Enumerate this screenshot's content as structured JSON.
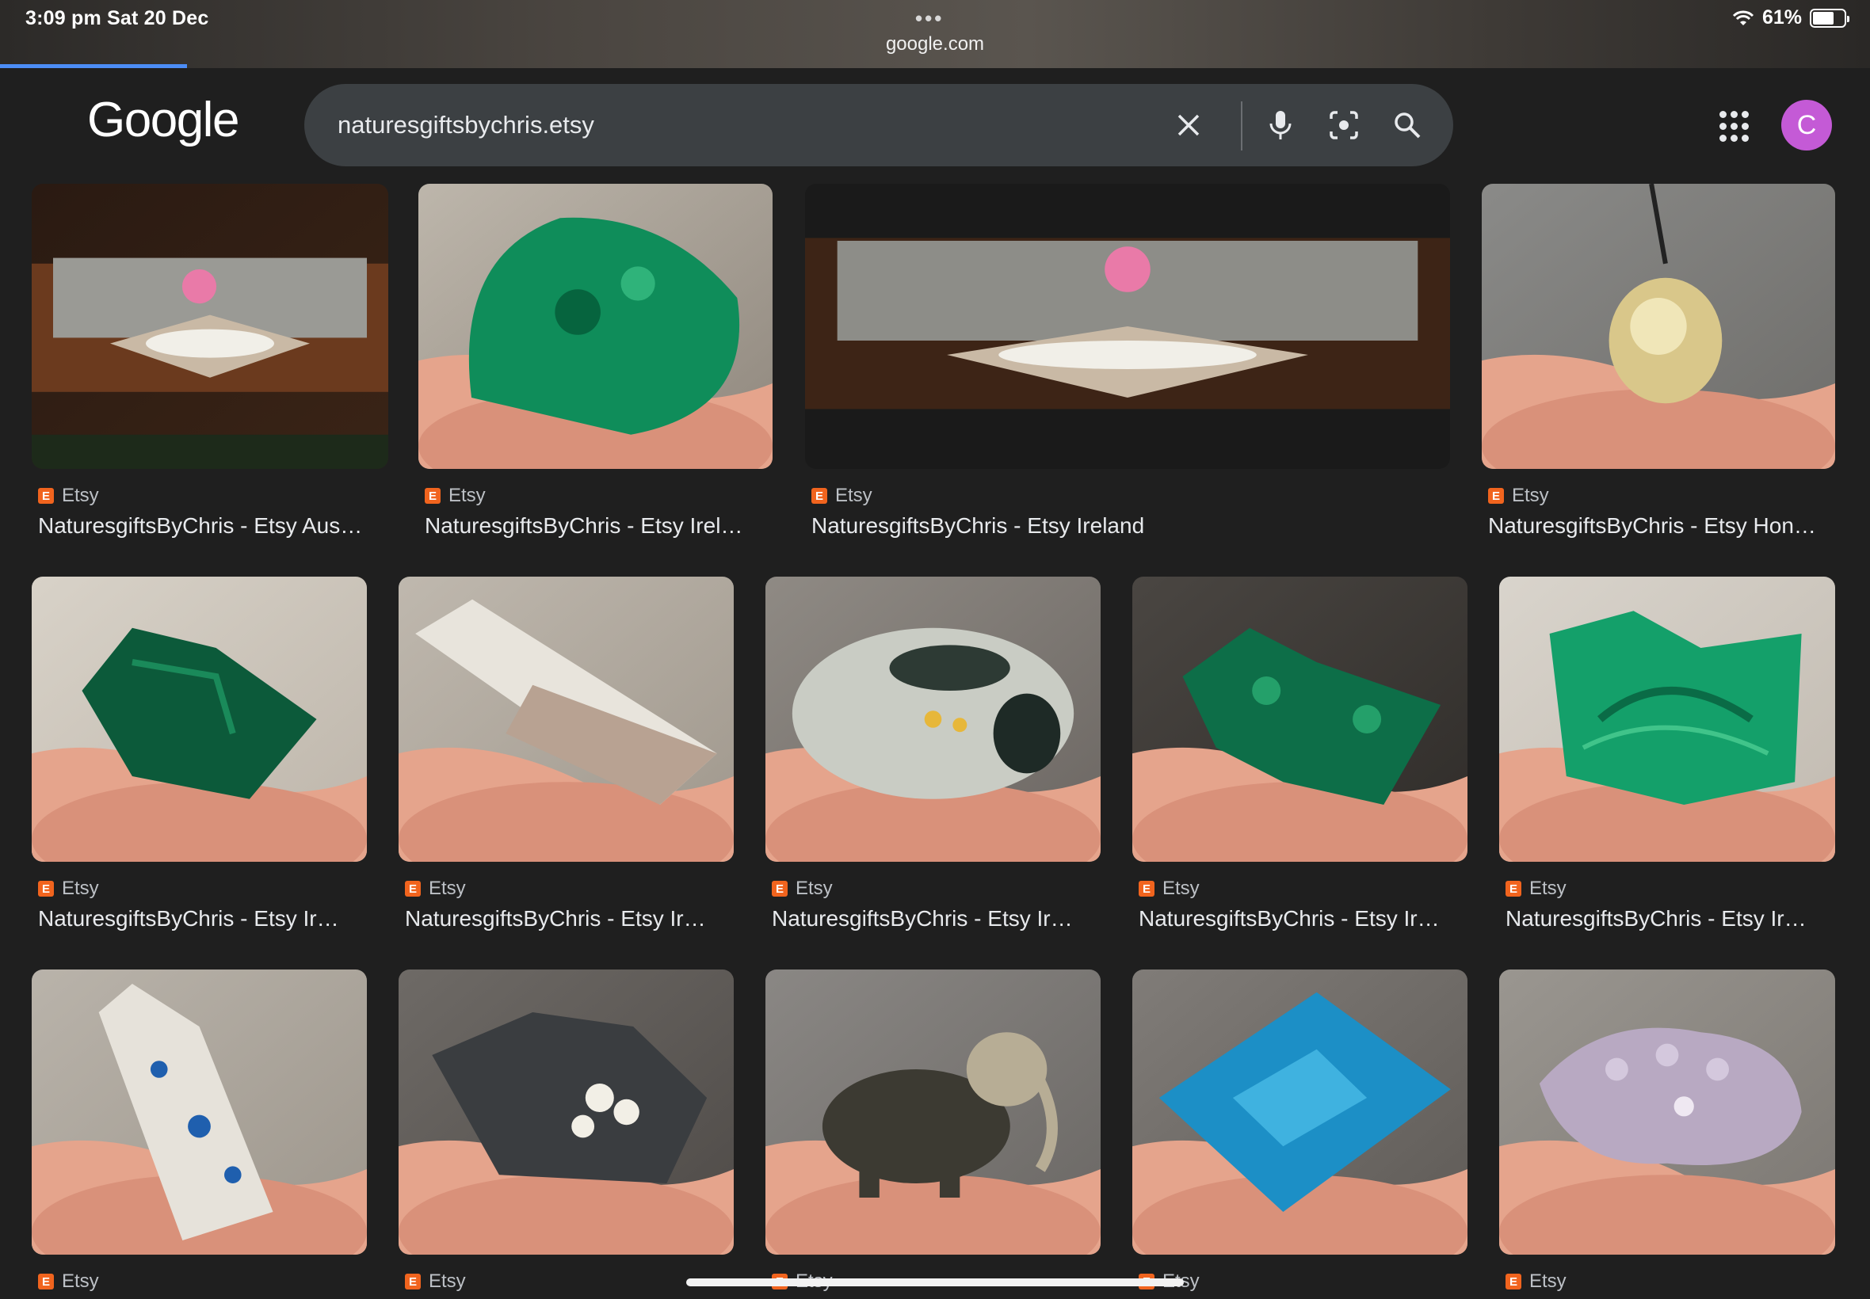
{
  "status": {
    "time": "3:09 pm  Sat 20 Dec",
    "battery": "61%",
    "battery_level": 0.61,
    "url": "google.com"
  },
  "header": {
    "logo": "Google",
    "query": "naturesgiftsbychris.etsy",
    "avatar_letter": "C"
  },
  "results": [
    {
      "source": "Etsy",
      "title": "NaturesgiftsByChris - Etsy Aus…",
      "image": "om-altar-tray"
    },
    {
      "source": "Etsy",
      "title": "NaturesgiftsByChris - Etsy Irel…",
      "image": "malachite-freeform"
    },
    {
      "source": "Etsy",
      "title": "NaturesgiftsByChris - Etsy Ireland",
      "image": "om-altar-wide"
    },
    {
      "source": "Etsy",
      "title": "NaturesgiftsByChris - Etsy Hon…",
      "image": "rutilated-quartz-pendant"
    },
    {
      "source": "Etsy",
      "title": "NaturesgiftsByChris - Etsy Ir…",
      "image": "malachite-rough"
    },
    {
      "source": "Etsy",
      "title": "NaturesgiftsByChris - Etsy Ir…",
      "image": "calcite-tower"
    },
    {
      "source": "Etsy",
      "title": "NaturesgiftsByChris - Etsy Ir…",
      "image": "ocean-jasper-palmstone"
    },
    {
      "source": "Etsy",
      "title": "NaturesgiftsByChris - Etsy Ir…",
      "image": "malachite-cluster"
    },
    {
      "source": "Etsy",
      "title": "NaturesgiftsByChris - Etsy Ir…",
      "image": "malachite-slab"
    },
    {
      "source": "Etsy",
      "title": "",
      "image": "k2-jasper-tower"
    },
    {
      "source": "Etsy",
      "title": "",
      "image": "prehnite-on-basalt"
    },
    {
      "source": "Etsy",
      "title": "",
      "image": "jasper-elephant"
    },
    {
      "source": "Etsy",
      "title": "",
      "image": "blue-apatite-diamond"
    },
    {
      "source": "Etsy",
      "title": "",
      "image": "grape-agate"
    }
  ]
}
